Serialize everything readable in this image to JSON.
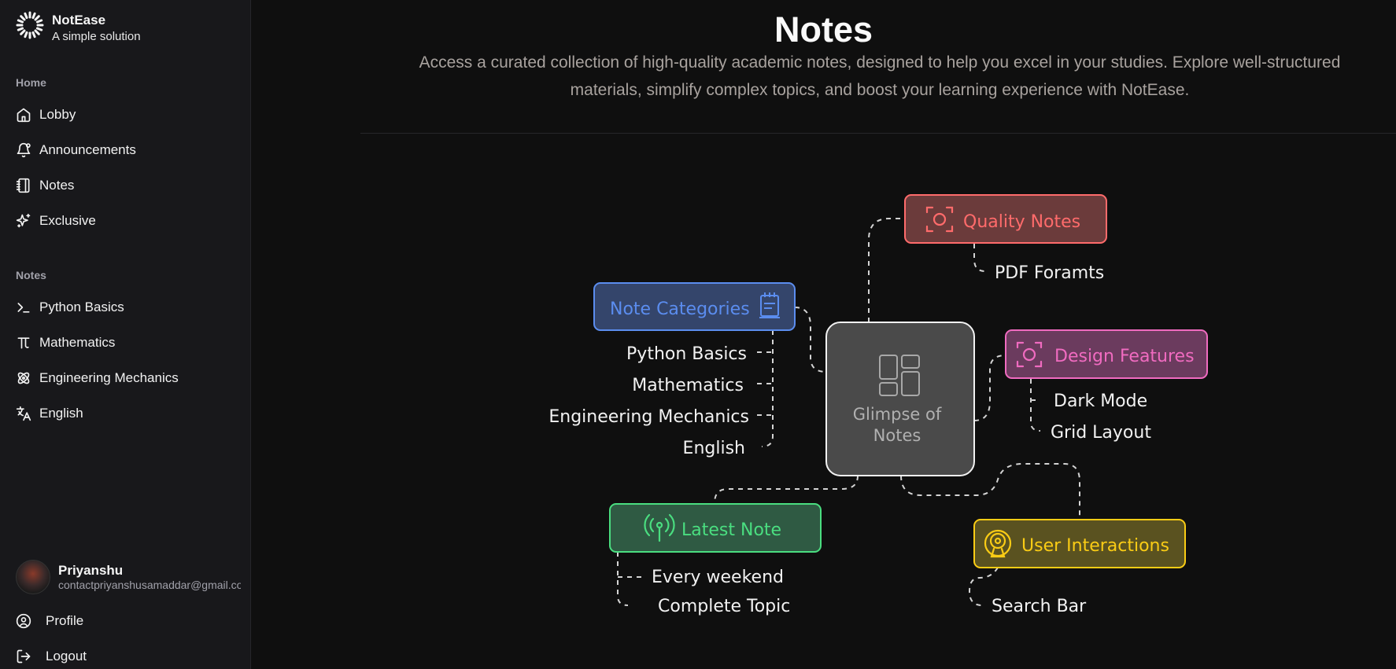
{
  "brand": {
    "name": "NotEase",
    "tagline": "A simple solution"
  },
  "sidebar": {
    "home_label": "Home",
    "home_items": [
      {
        "label": "Lobby",
        "icon": "home-icon"
      },
      {
        "label": "Announcements",
        "icon": "bell-icon"
      },
      {
        "label": "Notes",
        "icon": "notebook-icon"
      },
      {
        "label": "Exclusive",
        "icon": "sparkles-icon"
      }
    ],
    "notes_label": "Notes",
    "notes_items": [
      {
        "label": "Python Basics",
        "icon": "terminal-icon"
      },
      {
        "label": "Mathematics",
        "icon": "pi-icon"
      },
      {
        "label": "Engineering Mechanics",
        "icon": "atom-icon"
      },
      {
        "label": "English",
        "icon": "languages-icon"
      }
    ],
    "user": {
      "name": "Priyanshu",
      "email": "contactpriyanshusamaddar@gmail.com"
    },
    "footer_items": [
      {
        "label": "Profile",
        "icon": "user-circle-icon"
      },
      {
        "label": "Logout",
        "icon": "logout-icon"
      }
    ]
  },
  "main": {
    "title": "Notes",
    "subtitle_line1": "Access a curated collection of high-quality academic notes, designed to help you excel in your studies. Explore well-structured",
    "subtitle_line2": "materials, simplify complex topics, and boost your learning experience with NotEase."
  },
  "diagram": {
    "center": {
      "line1": "Glimpse of",
      "line2": "Notes"
    },
    "quality": {
      "label": "Quality Notes",
      "items": [
        "PDF Foramts"
      ]
    },
    "categories": {
      "label": "Note Categories",
      "items": [
        "Python Basics",
        "Mathematics",
        "Engineering Mechanics",
        "English"
      ]
    },
    "design": {
      "label": "Design Features",
      "items": [
        "Dark Mode",
        "Grid Layout"
      ]
    },
    "latest": {
      "label": "Latest Note",
      "items": [
        "Every weekend",
        "Complete Topic"
      ]
    },
    "interactions": {
      "label": "User Interactions",
      "items": [
        "Search Bar"
      ]
    }
  },
  "colors": {
    "quality": "#ff6b6b",
    "categories": "#5b8def",
    "design": "#f06bc0",
    "latest": "#4ade80",
    "interactions": "#facc15"
  }
}
